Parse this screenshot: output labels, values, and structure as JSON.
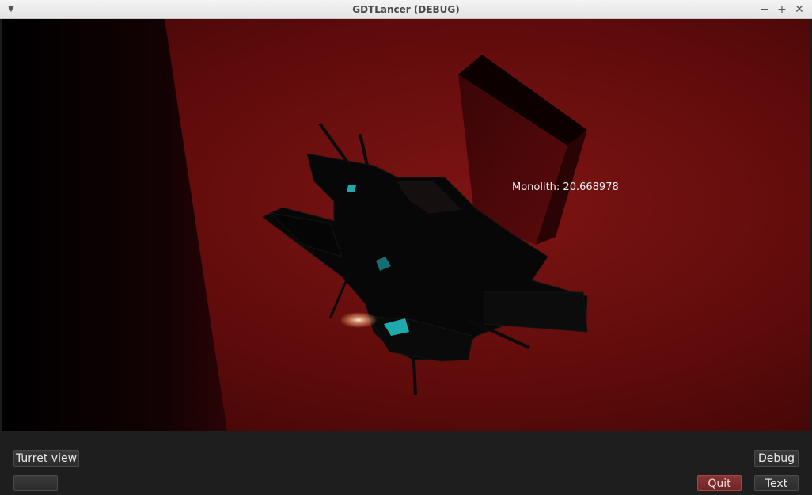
{
  "window": {
    "title": "GDTLancer (DEBUG)"
  },
  "titlebar": {
    "menu_icon": "chevron-down-icon",
    "minimize_glyph": "−",
    "maximize_glyph": "+",
    "close_glyph": "✕"
  },
  "scene": {
    "background_color": "#5a0a0a",
    "wall_color": "#150103",
    "ship_color": "#080808",
    "glow_color": "#2fbfc4",
    "monolith_label": "Monolith: 20.668978"
  },
  "hud": {
    "turret_view_label": "Turret view",
    "blank_button_label": "",
    "debug_label": "Debug",
    "quit_label": "Quit",
    "text_label": "Text",
    "quit_color": "#7c2c2c"
  }
}
